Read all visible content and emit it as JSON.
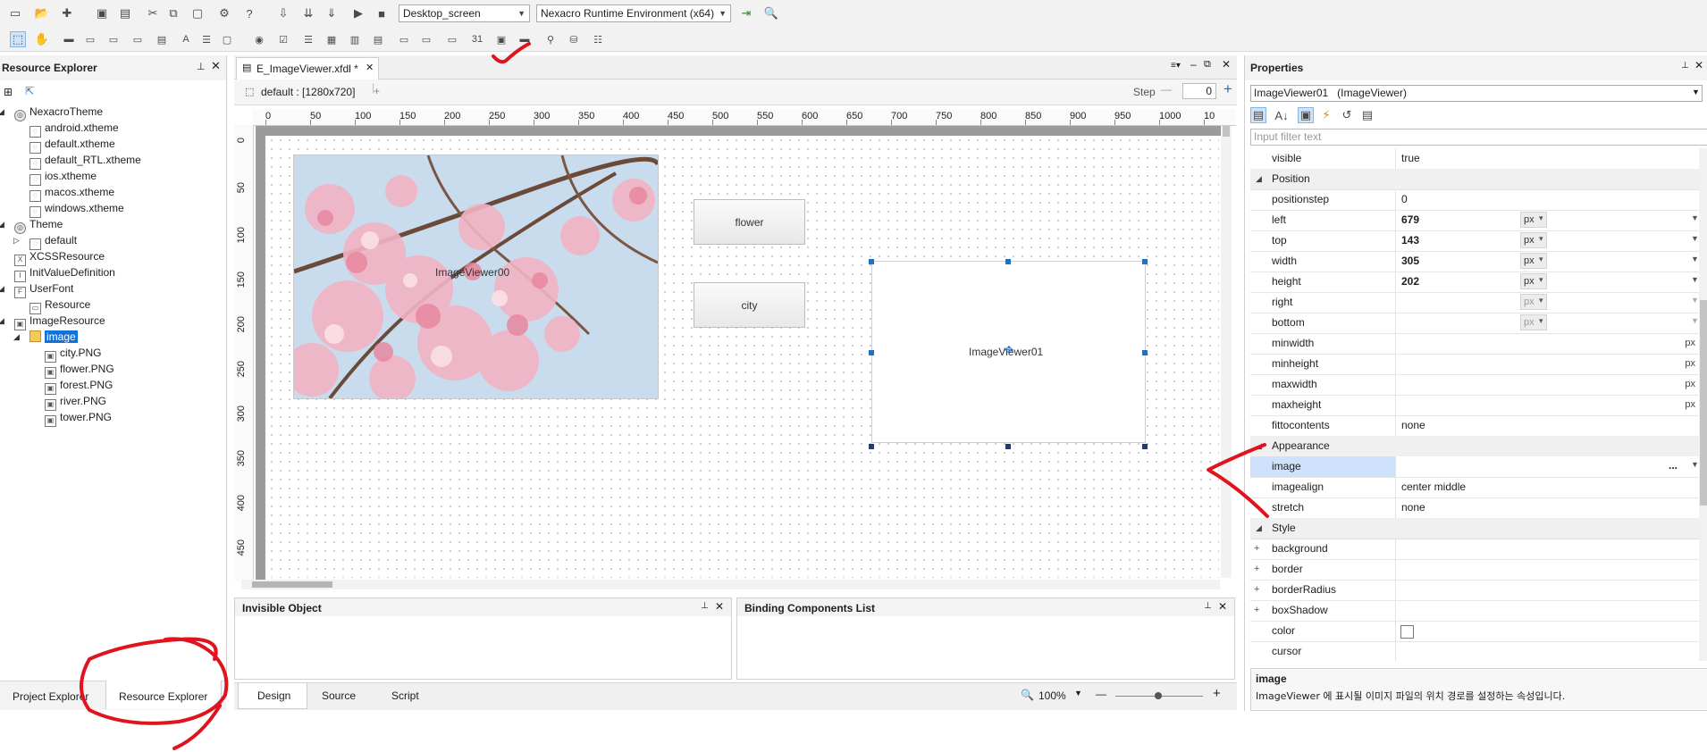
{
  "toolbar": {
    "screen_combo": "Desktop_screen",
    "runtime_combo": "Nexacro Runtime Environment (x64)"
  },
  "resource_explorer": {
    "title": "Resource Explorer",
    "tree": [
      {
        "label": "NexacroTheme",
        "level": 0,
        "expanded": true,
        "icon": "theme-icon"
      },
      {
        "label": "android.xtheme",
        "level": 1,
        "icon": "theme-file-icon"
      },
      {
        "label": "default.xtheme",
        "level": 1,
        "icon": "theme-file-icon"
      },
      {
        "label": "default_RTL.xtheme",
        "level": 1,
        "icon": "theme-file-icon"
      },
      {
        "label": "ios.xtheme",
        "level": 1,
        "icon": "theme-file-icon"
      },
      {
        "label": "macos.xtheme",
        "level": 1,
        "icon": "theme-file-icon"
      },
      {
        "label": "windows.xtheme",
        "level": 1,
        "icon": "theme-file-icon"
      },
      {
        "label": "Theme",
        "level": 0,
        "expanded": true,
        "icon": "theme-icon"
      },
      {
        "label": "default",
        "level": 1,
        "collapsed": true,
        "icon": "theme-file-icon"
      },
      {
        "label": "XCSSResource",
        "level": 0,
        "icon": "xcss-icon"
      },
      {
        "label": "InitValueDefinition",
        "level": 0,
        "icon": "initvalue-icon"
      },
      {
        "label": "UserFont",
        "level": 0,
        "expanded": true,
        "icon": "font-icon"
      },
      {
        "label": "Resource",
        "level": 1,
        "icon": "font-file-icon"
      },
      {
        "label": "ImageResource",
        "level": 0,
        "expanded": true,
        "icon": "image-resource-icon"
      },
      {
        "label": "image",
        "level": 1,
        "expanded": true,
        "selected": true,
        "icon": "folder-icon"
      },
      {
        "label": "city.PNG",
        "level": 2,
        "icon": "image-file-icon"
      },
      {
        "label": "flower.PNG",
        "level": 2,
        "icon": "image-file-icon"
      },
      {
        "label": "forest.PNG",
        "level": 2,
        "icon": "image-file-icon"
      },
      {
        "label": "river.PNG",
        "level": 2,
        "icon": "image-file-icon"
      },
      {
        "label": "tower.PNG",
        "level": 2,
        "icon": "image-file-icon"
      }
    ],
    "bottom_tabs": [
      "Project Explorer",
      "Resource Explorer"
    ]
  },
  "editor": {
    "file_tab": "E_ImageViewer.xfdl *",
    "screen_label": "default : [1280x720]",
    "step_label": "Step",
    "step_value": "0",
    "ruler_h": [
      "0",
      "50",
      "100",
      "150",
      "200",
      "250",
      "300",
      "350",
      "400",
      "450",
      "500",
      "550",
      "600",
      "650",
      "700",
      "750",
      "800",
      "850",
      "900",
      "950",
      "1000",
      "10"
    ],
    "ruler_v": [
      "0",
      "50",
      "100",
      "150",
      "200",
      "250",
      "300",
      "350",
      "400",
      "450"
    ],
    "components": {
      "imageviewer00": "ImageViewer00",
      "flower_button": "flower",
      "city_button": "city",
      "imageviewer01": "ImageViewer01"
    },
    "bottom_tabs": [
      "Design",
      "Source",
      "Script"
    ],
    "zoom": "100%",
    "invisible_object_title": "Invisible Object",
    "binding_list_title": "Binding Components List"
  },
  "properties": {
    "title": "Properties",
    "object_selector": "ImageViewer01   (ImageViewer)",
    "filter_placeholder": "Input filter text",
    "rows": {
      "visible": {
        "name": "visible",
        "value": "true"
      },
      "position_cat": "Position",
      "positionstep": {
        "name": "positionstep",
        "value": "0"
      },
      "left": {
        "name": "left",
        "value": "679",
        "unit": "px"
      },
      "top": {
        "name": "top",
        "value": "143",
        "unit": "px"
      },
      "width": {
        "name": "width",
        "value": "305",
        "unit": "px"
      },
      "height": {
        "name": "height",
        "value": "202",
        "unit": "px"
      },
      "right": {
        "name": "right",
        "value": "",
        "unit": "px"
      },
      "bottom": {
        "name": "bottom",
        "value": "",
        "unit": "px"
      },
      "minwidth": {
        "name": "minwidth",
        "unit": "px"
      },
      "minheight": {
        "name": "minheight",
        "unit": "px"
      },
      "maxwidth": {
        "name": "maxwidth",
        "unit": "px"
      },
      "maxheight": {
        "name": "maxheight",
        "unit": "px"
      },
      "fittocontents": {
        "name": "fittocontents",
        "value": "none"
      },
      "appearance_cat": "Appearance",
      "image": {
        "name": "image",
        "value": "",
        "button": "..."
      },
      "imagealign": {
        "name": "imagealign",
        "value": "center middle"
      },
      "stretch": {
        "name": "stretch",
        "value": "none"
      },
      "style_cat": "Style",
      "background": {
        "name": "background"
      },
      "border": {
        "name": "border"
      },
      "borderRadius": {
        "name": "borderRadius"
      },
      "boxShadow": {
        "name": "boxShadow"
      },
      "color": {
        "name": "color"
      },
      "cursor": {
        "name": "cursor"
      }
    },
    "help_title": "image",
    "help_text": "ImageViewer 에 표시될 이미지 파일의 위치 경로를 설정하는 속성입니다."
  },
  "annotation_color": "#e0141e"
}
